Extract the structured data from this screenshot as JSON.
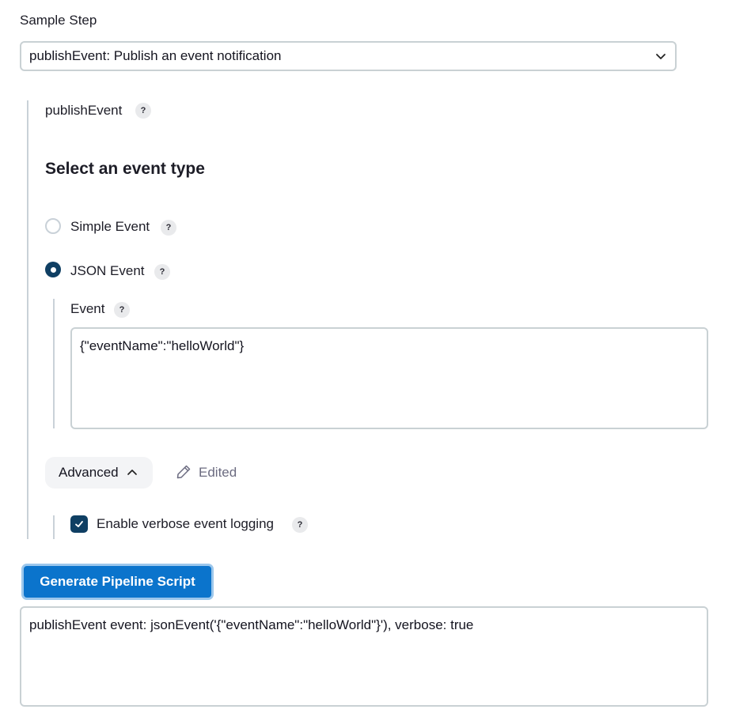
{
  "sample_step": {
    "label": "Sample Step",
    "selected": "publishEvent: Publish an event notification"
  },
  "step": {
    "name": "publishEvent",
    "help": "?"
  },
  "event_type": {
    "heading": "Select an event type",
    "options": [
      {
        "label": "Simple Event",
        "selected": false,
        "help": "?"
      },
      {
        "label": "JSON Event",
        "selected": true,
        "help": "?"
      }
    ]
  },
  "event_field": {
    "label": "Event",
    "help": "?",
    "value": "{\"eventName\":\"helloWorld\"}"
  },
  "advanced": {
    "label": "Advanced",
    "expanded": true,
    "edited_label": "Edited"
  },
  "verbose": {
    "label": "Enable verbose event logging",
    "checked": true,
    "help": "?"
  },
  "generate_button": {
    "label": "Generate Pipeline Script"
  },
  "output": {
    "value": "publishEvent event: jsonEvent('{\"eventName\":\"helloWorld\"}'), verbose: true"
  }
}
